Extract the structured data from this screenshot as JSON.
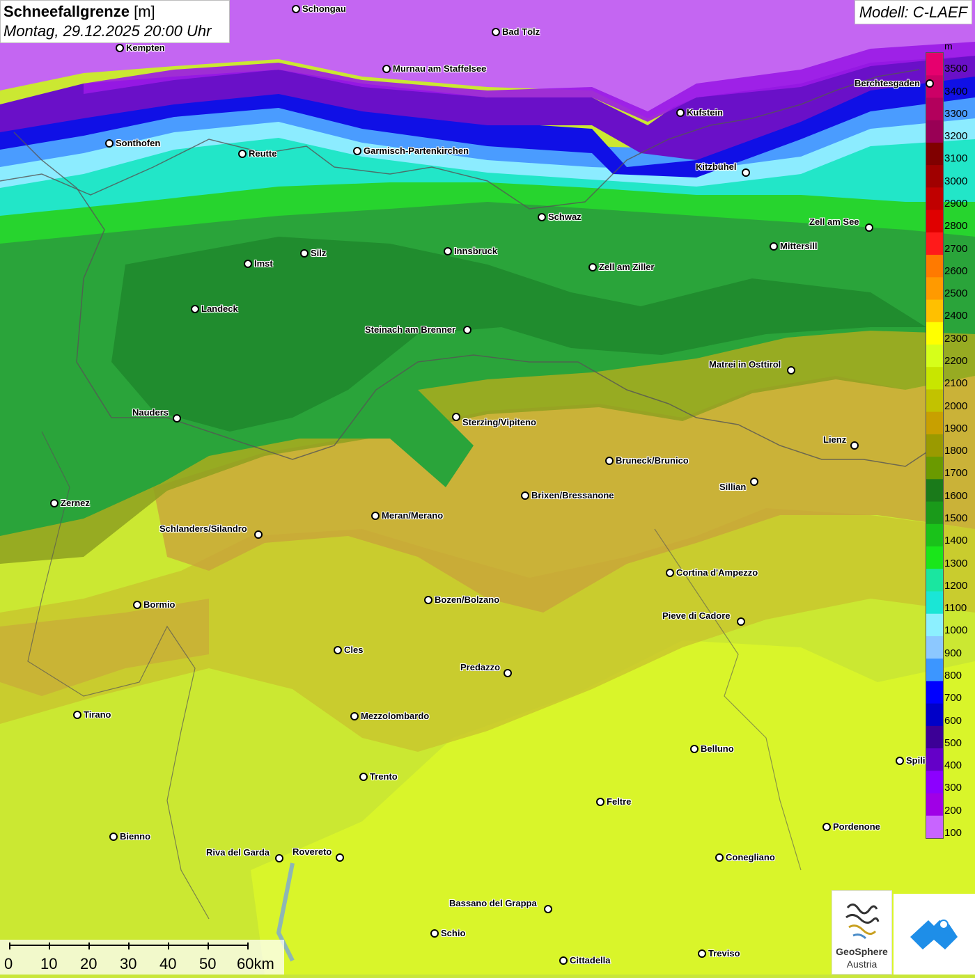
{
  "title": {
    "variable": "Schneefallgrenze",
    "unit": "[m]",
    "datetime": "Montag, 29.12.2025 20:00 Uhr"
  },
  "model_label": "Modell: C-LAEF",
  "legend": {
    "unit": "m",
    "classes": [
      {
        "label": "3500",
        "color": "#e6006e"
      },
      {
        "label": "3400",
        "color": "#cc0066"
      },
      {
        "label": "3300",
        "color": "#b3005c"
      },
      {
        "label": "3200",
        "color": "#990055"
      },
      {
        "label": "3100",
        "color": "#800000"
      },
      {
        "label": "3000",
        "color": "#a00000"
      },
      {
        "label": "2900",
        "color": "#c00000"
      },
      {
        "label": "2800",
        "color": "#e00000"
      },
      {
        "label": "2700",
        "color": "#ff1a1a"
      },
      {
        "label": "2600",
        "color": "#ff7a00"
      },
      {
        "label": "2500",
        "color": "#ff9a00"
      },
      {
        "label": "2400",
        "color": "#ffc000"
      },
      {
        "label": "2300",
        "color": "#ffff00"
      },
      {
        "label": "2200",
        "color": "#d6ff1a"
      },
      {
        "label": "2100",
        "color": "#c8e600"
      },
      {
        "label": "2000",
        "color": "#c2c200"
      },
      {
        "label": "1900",
        "color": "#c8a000"
      },
      {
        "label": "1800",
        "color": "#9a9a00"
      },
      {
        "label": "1700",
        "color": "#6a9a00"
      },
      {
        "label": "1600",
        "color": "#1a7a1a"
      },
      {
        "label": "1500",
        "color": "#1a9a1a"
      },
      {
        "label": "1400",
        "color": "#1ac21a"
      },
      {
        "label": "1300",
        "color": "#1ae61a"
      },
      {
        "label": "1200",
        "color": "#1ae6a0"
      },
      {
        "label": "1100",
        "color": "#1ae6d6"
      },
      {
        "label": "1000",
        "color": "#8cf0ff"
      },
      {
        "label": "900",
        "color": "#8cc8ff"
      },
      {
        "label": "800",
        "color": "#3c96ff"
      },
      {
        "label": "700",
        "color": "#0000ff"
      },
      {
        "label": "600",
        "color": "#0000c8"
      },
      {
        "label": "500",
        "color": "#3c0096"
      },
      {
        "label": "400",
        "color": "#6400c8"
      },
      {
        "label": "300",
        "color": "#8c00ff"
      },
      {
        "label": "200",
        "color": "#a000e6"
      },
      {
        "label": "100",
        "color": "#c864ff"
      }
    ]
  },
  "cities": [
    {
      "name": "Schongau"
    },
    {
      "name": "Bad Tölz"
    },
    {
      "name": "Kempten"
    },
    {
      "name": "Murnau am Staffelsee"
    },
    {
      "name": "Berchtesgaden"
    },
    {
      "name": "Kufstein"
    },
    {
      "name": "Sonthofen"
    },
    {
      "name": "Reutte"
    },
    {
      "name": "Garmisch-Partenkirchen"
    },
    {
      "name": "Kitzbühel"
    },
    {
      "name": "Schwaz"
    },
    {
      "name": "Zell am See"
    },
    {
      "name": "Innsbruck"
    },
    {
      "name": "Mittersill"
    },
    {
      "name": "Imst"
    },
    {
      "name": "Silz"
    },
    {
      "name": "Zell am Ziller"
    },
    {
      "name": "Landeck"
    },
    {
      "name": "Steinach am Brenner"
    },
    {
      "name": "Matrei in Osttirol"
    },
    {
      "name": "Nauders"
    },
    {
      "name": "Sterzing/Vipiteno"
    },
    {
      "name": "Lienz"
    },
    {
      "name": "Bruneck/Brunico"
    },
    {
      "name": "Sillian"
    },
    {
      "name": "Zernez"
    },
    {
      "name": "Brixen/Bressanone"
    },
    {
      "name": "Meran/Merano"
    },
    {
      "name": "Schlanders/Silandro"
    },
    {
      "name": "Cortina d'Ampezzo"
    },
    {
      "name": "Bozen/Bolzano"
    },
    {
      "name": "Bormio"
    },
    {
      "name": "Pieve di Cadore"
    },
    {
      "name": "Cles"
    },
    {
      "name": "Predazzo"
    },
    {
      "name": "Tirano"
    },
    {
      "name": "Mezzolombardo"
    },
    {
      "name": "Belluno"
    },
    {
      "name": "Spili"
    },
    {
      "name": "Trento"
    },
    {
      "name": "Feltre"
    },
    {
      "name": "Pordenone"
    },
    {
      "name": "Bienno"
    },
    {
      "name": "Riva del Garda"
    },
    {
      "name": "Rovereto"
    },
    {
      "name": "Conegliano"
    },
    {
      "name": "Bassano del Grappa"
    },
    {
      "name": "Schio"
    },
    {
      "name": "Treviso"
    },
    {
      "name": "Cittadella"
    }
  ],
  "scale_bar": {
    "labels": [
      "0",
      "10",
      "20",
      "30",
      "40",
      "50",
      "60km"
    ]
  },
  "logos": {
    "geosphere_line1": "GeoSphere",
    "geosphere_line2": "Austria"
  }
}
